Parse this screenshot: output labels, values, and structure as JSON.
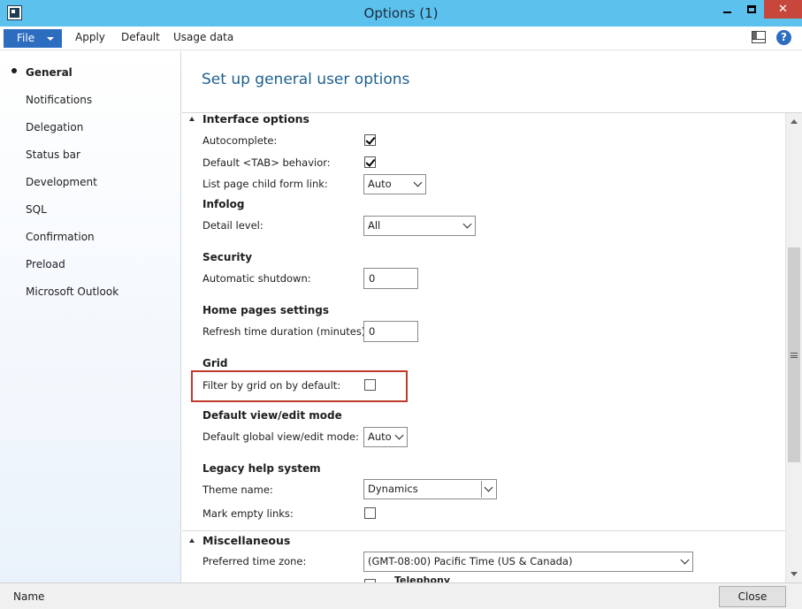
{
  "window": {
    "title": "Options (1)",
    "app_icon": "dynamics-ax-icon",
    "minimize_icon": "minimize-icon",
    "maximize_icon": "maximize-icon",
    "close_glyph": "✕"
  },
  "menu": {
    "file_label": "File",
    "items": [
      "Apply",
      "Default",
      "Usage data"
    ],
    "layout_icon": "layout-icon",
    "help_glyph": "?"
  },
  "nav": {
    "items": [
      "General",
      "Notifications",
      "Delegation",
      "Status bar",
      "Development",
      "SQL",
      "Confirmation",
      "Preload",
      "Microsoft Outlook"
    ],
    "active": "General"
  },
  "page": {
    "title": "Set up general user options"
  },
  "interface": {
    "section_title": "Interface options",
    "autocomplete_label": "Autocomplete:",
    "autocomplete_checked": true,
    "default_tab_label": "Default <TAB> behavior:",
    "default_tab_checked": true,
    "list_page_label": "List page child form link:",
    "list_page_value": "Auto",
    "infolog_group": "Infolog",
    "detail_level_label": "Detail level:",
    "detail_level_value": "All",
    "security_group": "Security",
    "auto_shutdown_label": "Automatic shutdown:",
    "auto_shutdown_value": "0",
    "home_group": "Home pages settings",
    "refresh_label": "Refresh time duration (minutes):",
    "refresh_value": "0",
    "grid_group": "Grid",
    "filter_grid_label": "Filter by grid on by default:",
    "filter_grid_checked": false,
    "view_edit_group": "Default view/edit mode",
    "view_edit_label": "Default global view/edit mode:",
    "view_edit_value": "Auto",
    "legacy_help_group": "Legacy help system",
    "theme_label": "Theme name:",
    "theme_value": "Dynamics",
    "mark_empty_label": "Mark empty links:",
    "mark_empty_checked": false
  },
  "misc": {
    "section_title": "Miscellaneous",
    "timezone_label": "Preferred time zone:",
    "timezone_value": "(GMT-08:00) Pacific Time (US & Canada)",
    "telephony_label": "Telephony"
  },
  "status": {
    "name_label": "Name",
    "close_label": "Close"
  },
  "colors": {
    "titlebar": "#5dc1ee",
    "file_button": "#2d6dc0",
    "close_window": "#c7473c",
    "page_title": "#1c5f8f",
    "highlight": "#c0392b"
  }
}
